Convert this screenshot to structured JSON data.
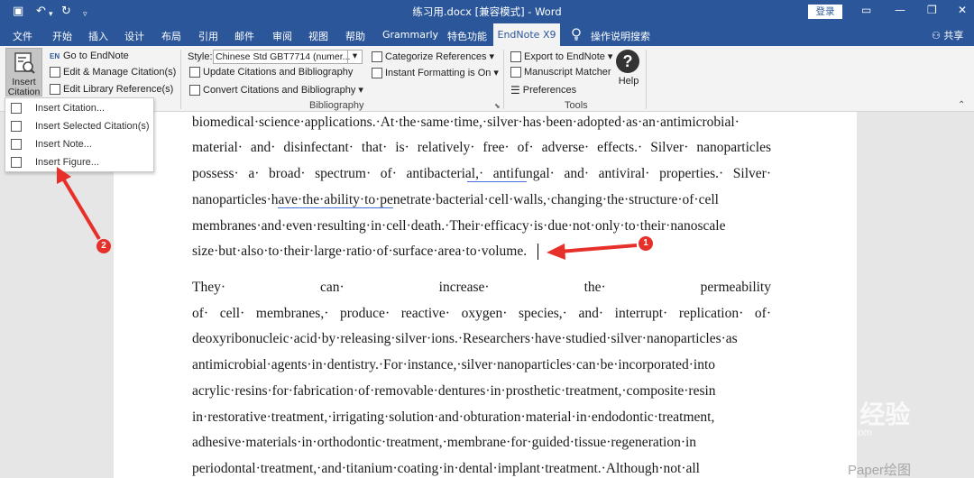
{
  "titlebar": {
    "title": "练习用.docx [兼容模式] - Word",
    "login": "登录"
  },
  "tabs": {
    "file": "文件",
    "home": "开始",
    "insert": "插入",
    "design": "设计",
    "layout": "布局",
    "references": "引用",
    "mailings": "邮件",
    "review": "审阅",
    "view": "视图",
    "help": "帮助",
    "grammarly": "Grammarly",
    "special": "特色功能",
    "endnote": "EndNote X9",
    "tell_me": "操作说明搜索",
    "share": "共享"
  },
  "ribbon": {
    "insert_citation_line1": "Insert",
    "insert_citation_line2": "Citation",
    "go_to_endnote": "Go to EndNote",
    "edit_manage": "Edit & Manage Citation(s)",
    "edit_library": "Edit Library Reference(s)",
    "style_label": "Style:",
    "style_value": "Chinese Std GBT7714 (numer...",
    "update_citations": "Update Citations and Bibliography",
    "convert_citations": "Convert Citations and Bibliography",
    "categorize": "Categorize References",
    "instant_formatting": "Instant Formatting is On",
    "export": "Export to EndNote",
    "manuscript_matcher": "Manuscript Matcher",
    "preferences": "Preferences",
    "help": "Help",
    "group_bibliography": "Bibliography",
    "group_tools": "Tools"
  },
  "dropdown": {
    "insert_citation": "Insert Citation...",
    "insert_selected": "Insert Selected Citation(s)",
    "insert_note": "Insert Note...",
    "insert_figure": "Insert Figure..."
  },
  "document": {
    "lines": [
      "biomedical·science·applications.·At·the·same·time,·silver·has·been·adopted·as·an·antimicrobial·",
      "material·  and·  disinfectant·  that·  is·  relatively·  free·  of·  adverse·  effects.·  Silver·  nanoparticles",
      "possess·  a·  broad·  spectrum·  of·  antibacterial,·  antifungal·  and·  antiviral·  properties.·  Silver·",
      "nanoparticles·have·the·ability·to·penetrate·bacterial·cell·walls,·changing·the·structure·of·cell",
      "membranes·and·even·resulting·in·cell·death.·Their·efficacy·is·due·not·only·to·their·nanoscale",
      "size·but·also·to·their·large·ratio·of·surface·area·to·volume.",
      "They·                can·                increase·                the·                permeability",
      "of·  cell·  membranes,·  produce·  reactive·  oxygen·  species,·  and·  interrupt·  replication·  of·",
      "deoxyribonucleic·acid·by·releasing·silver·ions.·Researchers·have·studied·silver·nanoparticles·as",
      "antimicrobial·agents·in·dentistry.·For·instance,·silver·nanoparticles·can·be·incorporated·into",
      "acrylic·resins·for·fabrication·of·removable·dentures·in·prosthetic·treatment,·composite·resin",
      "in·restorative·treatment,·irrigating·solution·and·obturation·material·in·endodontic·treatment,",
      "adhesive·materials·in·orthodontic·treatment,·membrane·for·guided·tissue·regeneration·in",
      "periodontal·treatment,·and·titanium·coating·in·dental·implant·treatment.·Although·not·all"
    ]
  },
  "annotations": {
    "badge1": "1",
    "badge2": "2"
  },
  "watermark": {
    "main": "Bai du 经验",
    "sub": "jingyan.baidu.com",
    "corner": "Paper绘图"
  },
  "colors": {
    "word_blue": "#2b579a",
    "annotation_red": "#e8302a"
  }
}
